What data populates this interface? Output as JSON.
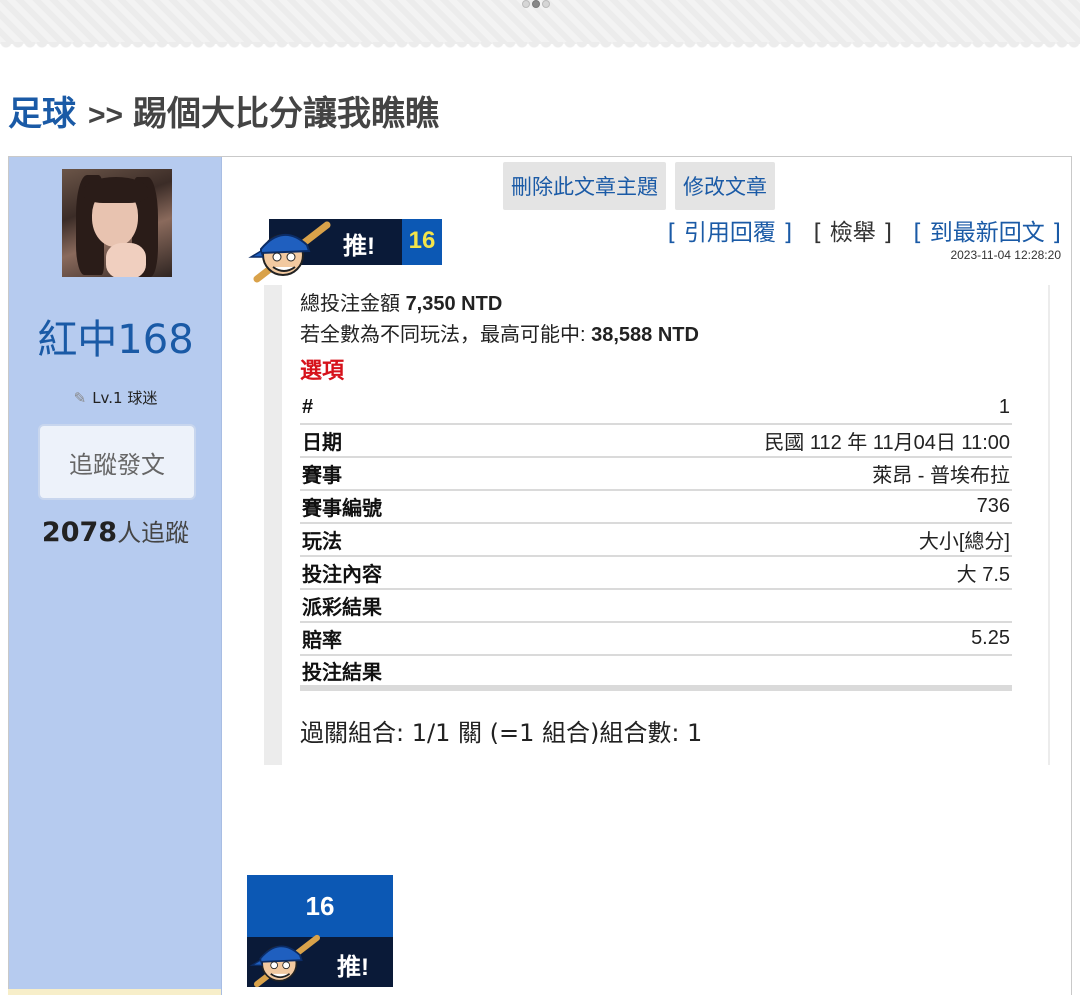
{
  "breadcrumb": {
    "category": "足球",
    "separator": ">>",
    "title": "踢個大比分讓我瞧瞧"
  },
  "user": {
    "name": "紅中168",
    "level": "Lv.1 球迷",
    "follow_label": "追蹤發文",
    "followers_count": "2078",
    "followers_suffix": "人追蹤"
  },
  "admin": {
    "delete_topic": "刪除此文章主題",
    "edit_post": "修改文章"
  },
  "push": {
    "label": "推!",
    "count": "16"
  },
  "actions": {
    "quote_reply": "引用回覆",
    "report": "檢舉",
    "latest_reply": "到最新回文",
    "bracket_open": "[",
    "bracket_close": "]"
  },
  "timestamp": "2023-11-04 12:28:20",
  "bet": {
    "total_label": "總投注金額",
    "total_value": "7,350 NTD",
    "max_win_label": "若全數為不同玩法，最高可能中:",
    "max_win_value": "38,588 NTD",
    "options_heading": "選項",
    "rows": [
      {
        "key": "#",
        "value": "1"
      },
      {
        "key": "日期",
        "value": "民國 112 年 11月04日 11:00"
      },
      {
        "key": "賽事",
        "value": "萊昂 - 普埃布拉"
      },
      {
        "key": "賽事編號",
        "value": "736"
      },
      {
        "key": "玩法",
        "value": "大小[總分]"
      },
      {
        "key": "投注內容",
        "value": "大 7.5"
      },
      {
        "key": "派彩結果",
        "value": ""
      },
      {
        "key": "賠率",
        "value": "5.25"
      },
      {
        "key": "投注結果",
        "value": ""
      }
    ],
    "combo": "過關組合: 1/1 關 (=1 組合)組合數: 1"
  },
  "colors": {
    "link_blue": "#1a5aa6",
    "sidebar_blue": "#b6cbef",
    "badge_dark": "#0a1a38",
    "badge_blue": "#0c58b4",
    "badge_count": "#f4e44a",
    "options_red": "#d6121b"
  },
  "icons": [
    "pencil-icon",
    "baseball-mascot-icon"
  ]
}
